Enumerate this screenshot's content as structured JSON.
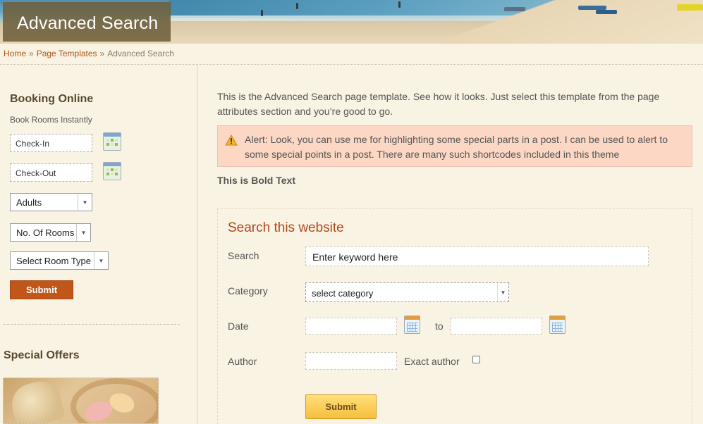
{
  "header": {
    "page_title": "Advanced Search"
  },
  "breadcrumb": {
    "items": [
      "Home",
      "Page Templates"
    ],
    "separator": "»",
    "current": "Advanced Search"
  },
  "sidebar": {
    "booking": {
      "title": "Booking Online",
      "subtitle": "Book Rooms Instantly",
      "check_in": "Check-In",
      "check_out": "Check-Out",
      "adults": "Adults",
      "rooms": "No. Of Rooms",
      "room_type": "Select Room Type",
      "submit": "Submit"
    },
    "special_offers": {
      "title": "Special Offers"
    }
  },
  "main": {
    "intro": "This is the Advanced Search page template. See how it looks. Just select this template from the page attributes section and you’re good to go.",
    "alert": "Alert: Look, you can use me for highlighting some special parts in a post. I can be used to alert to some special points in a post. There are many such shortcodes included in this theme",
    "bold_text": "This is Bold Text",
    "search_form": {
      "title": "Search this website",
      "search_label": "Search",
      "search_value": "Enter keyword here",
      "category_label": "Category",
      "category_value": "select category",
      "date_label": "Date",
      "date_to": "to",
      "author_label": "Author",
      "exact_author_label": "Exact author",
      "submit": "Submit"
    }
  },
  "colors": {
    "background": "#f9f3e4",
    "link": "#b05512",
    "side_submit": "#c0561a",
    "alert_bg": "#fbd7c4",
    "search_title": "#b0481b",
    "main_submit": "#f6bf3d"
  },
  "icons": [
    "calendar-icon",
    "warning-icon",
    "dropdown-arrow-icon",
    "checkbox"
  ]
}
